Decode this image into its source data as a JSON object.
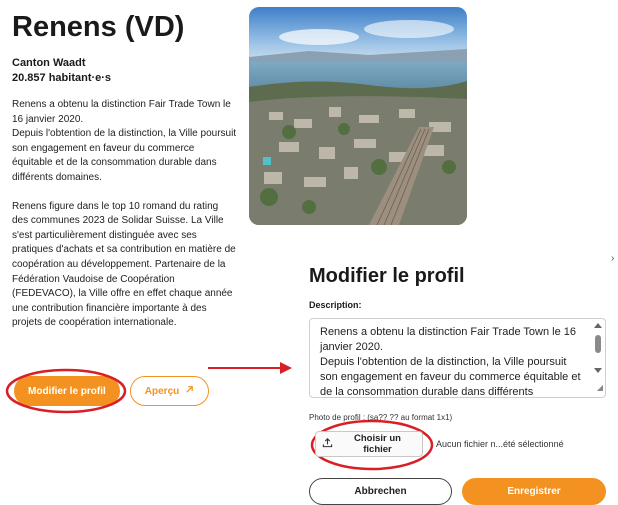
{
  "profile": {
    "title": "Renens (VD)",
    "canton": "Canton Waadt",
    "population": "20.857 habitant·e·s",
    "paragraph1": "Renens a obtenu la distinction Fair Trade Town le 16 janvier 2020.\nDepuis l'obtention de la distinction, la Ville poursuit son engagement en faveur du commerce équitable et de la consommation durable dans différents domaines.",
    "paragraph2": "Renens figure dans le top 10 romand du rating des communes 2023 de Solidar Suisse. La Ville s'est particulièrement distinguée avec ses pratiques d'achats et sa contribution en matière de coopération au développement. Partenaire de la Fédération Vaudoise de Coopération (FEDEVACO), la Ville offre en effet chaque année une contribution financière importante à des projets de coopération internationale.",
    "edit_label": "Modifier le profil",
    "preview_label": "Aperçu",
    "preview_icon": "arrow-up-right-icon"
  },
  "modal": {
    "title": "Modifier le profil",
    "description_label": "Description:",
    "description_text": "Renens a obtenu la distinction Fair Trade Town le 16 janvier 2020.\nDepuis l'obtention de la distinction, la Ville poursuit son engagement en faveur du commerce équitable et de la consommation durable dans différents domaines.",
    "photo_label": "Photo de profil : (sa?? ?? au format 1x1)",
    "file_button_label": "Choisir un fichier",
    "file_icon": "upload-icon",
    "file_status": "Aucun fichier n...été sélectionné",
    "cancel_label": "Abbrechen",
    "save_label": "Enregistrer",
    "close_glyph": "›"
  },
  "colors": {
    "accent": "#f39221",
    "annotation": "#d81f26"
  }
}
